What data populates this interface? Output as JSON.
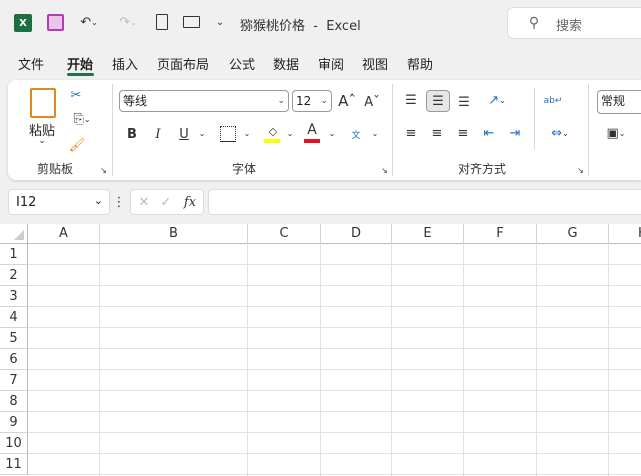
{
  "title_bar": {
    "doc_title": "猕猴桃价格",
    "separator": "-",
    "app": "Excel",
    "search_placeholder": "搜索"
  },
  "tabs": [
    {
      "label": "文件"
    },
    {
      "label": "开始",
      "active": true
    },
    {
      "label": "插入"
    },
    {
      "label": "页面布局"
    },
    {
      "label": "公式"
    },
    {
      "label": "数据"
    },
    {
      "label": "审阅"
    },
    {
      "label": "视图"
    },
    {
      "label": "帮助"
    }
  ],
  "ribbon": {
    "clipboard": {
      "paste": "粘贴",
      "group": "剪贴板"
    },
    "font": {
      "name": "等线",
      "size": "12",
      "bold": "B",
      "italic": "I",
      "underline": "U",
      "group": "字体",
      "font_color": "#e81123",
      "highlight_color": "#ffff00"
    },
    "alignment": {
      "group": "对齐方式"
    },
    "number": {
      "format": "常规"
    }
  },
  "formula_bar": {
    "name_box": "I12",
    "fx": "fx",
    "value": ""
  },
  "columns": [
    "A",
    "B",
    "C",
    "D",
    "E",
    "F",
    "G",
    "H"
  ],
  "rows": [
    "1",
    "2",
    "3",
    "4",
    "5",
    "6",
    "7",
    "8",
    "9",
    "10",
    "11"
  ],
  "accent": "#217346"
}
